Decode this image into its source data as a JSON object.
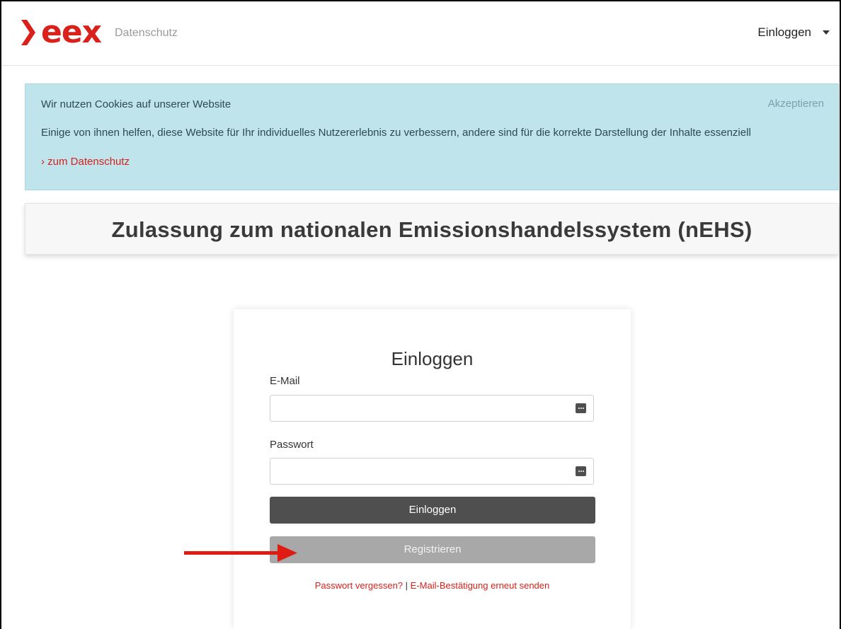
{
  "header": {
    "logo_text": "eex",
    "nav_link": "Datenschutz",
    "account_menu_label": "Einloggen",
    "brand_color": "#d9201a"
  },
  "cookie_banner": {
    "title": "Wir nutzen Cookies auf unserer Website",
    "accept_label": "Akzeptieren",
    "body": "Einige von ihnen helfen, diese Website für Ihr individuelles Nutzererlebnis zu verbessern, andere sind für die korrekte Darstellung der Inhalte essenziell",
    "privacy_link": "› zum Datenschutz",
    "background_color": "#bfe4eb"
  },
  "page_title": "Zulassung zum nationalen Emissionshandelssystem (nEHS)",
  "login": {
    "heading": "Einloggen",
    "email_label": "E-Mail",
    "email_value": "",
    "password_label": "Passwort",
    "password_value": "",
    "submit_label": "Einloggen",
    "register_label": "Registrieren",
    "forgot_password_link": "Passwort vergessen?",
    "separator": "|",
    "resend_confirmation_link": "E-Mail-Bestätigung erneut senden"
  },
  "icons": {
    "password_manager": "password-manager-icon",
    "annotation": "red-arrow-icon",
    "annotation_color": "#e01b12"
  }
}
